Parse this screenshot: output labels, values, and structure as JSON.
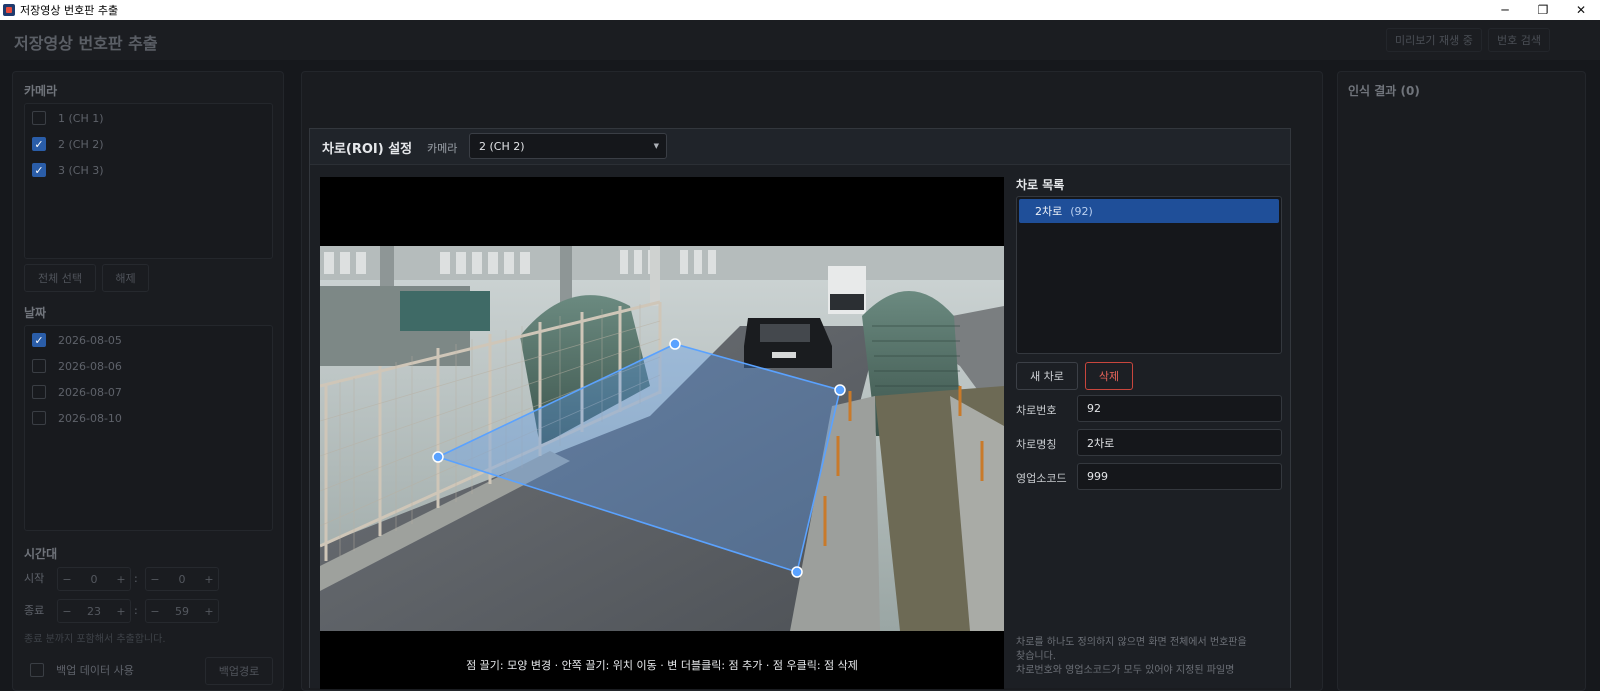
{
  "window": {
    "title": "저장영상 번호판 추출",
    "min": "─",
    "restore": "❐",
    "close": "✕"
  },
  "header": {
    "app_title": "저장영상 번호판 추출",
    "preview_status": "미리보기 재생 중",
    "search_button": "번호 검색"
  },
  "left": {
    "camera_title": "카메라",
    "cameras": [
      {
        "label": "1  (CH 1)",
        "checked": false
      },
      {
        "label": "2  (CH 2)",
        "checked": true
      },
      {
        "label": "3  (CH 3)",
        "checked": true
      }
    ],
    "select_all": "전체 선택",
    "clear": "해제",
    "date_title": "날짜",
    "dates": [
      {
        "label": "2026-08-05",
        "checked": true
      },
      {
        "label": "2026-08-06",
        "checked": false
      },
      {
        "label": "2026-08-07",
        "checked": false
      },
      {
        "label": "2026-08-10",
        "checked": false
      }
    ],
    "time_title": "시간대",
    "start_label": "시작",
    "end_label": "종료",
    "start_hour": "0",
    "start_min": "0",
    "end_hour": "23",
    "end_min": "59",
    "minus": "−",
    "plus": "+",
    "colon": ":",
    "time_note": "종료 분까지 포함해서 추출합니다.",
    "backup_label": "백업 데이터 사용",
    "backup_path_button": "백업경로"
  },
  "results": {
    "title": "인식 결과",
    "count": "(0)"
  },
  "modal": {
    "title": "차로(ROI) 설정",
    "camera_label": "카메라",
    "camera_value": "2  (CH 2)",
    "lane_list_title": "차로 목록",
    "lanes": [
      {
        "name": "2차로",
        "number": "(92)"
      }
    ],
    "new_lane": "새 차로",
    "delete": "삭제",
    "fields": {
      "lane_number_label": "차로번호",
      "lane_number": "92",
      "lane_name_label": "차로명칭",
      "lane_name": "2차로",
      "office_code_label": "영업소코드",
      "office_code": "999"
    },
    "hint": "점 끌기: 모양 변경 · 안쪽 끌기: 위치 이동 · 변 더블클릭: 점 추가 · 점 우클릭: 점 삭제",
    "note_line1": "차로를 하나도 정의하지 않으면 화면 전체에서 번호판을",
    "note_line2": "찾습니다.",
    "note_line3": "차로번호와 영업소코드가 모두 있어야 지정된 파일명"
  },
  "colors": {
    "accent": "#1f4f99",
    "roi": "#5a9cf0",
    "danger": "#e8645a"
  }
}
